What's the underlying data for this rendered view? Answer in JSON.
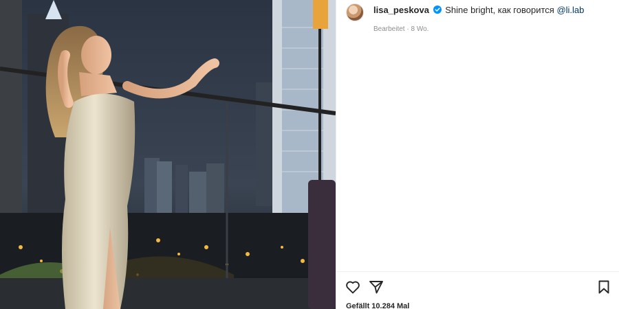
{
  "post": {
    "username": "lisa_peskova",
    "caption_text": "Shine bright, как говорится ",
    "mention": "@li.lab",
    "meta": "Bearbeitet · 8 Wo.",
    "likes": "Gefällt 10.284 Mal"
  },
  "icons": {
    "verified": "verified-badge-icon",
    "like": "heart-icon",
    "share": "paper-plane-icon",
    "save": "bookmark-icon"
  },
  "colors": {
    "verified": "#0095f6",
    "mention": "#00376b",
    "text": "#262626",
    "muted": "#8e8e8e"
  }
}
